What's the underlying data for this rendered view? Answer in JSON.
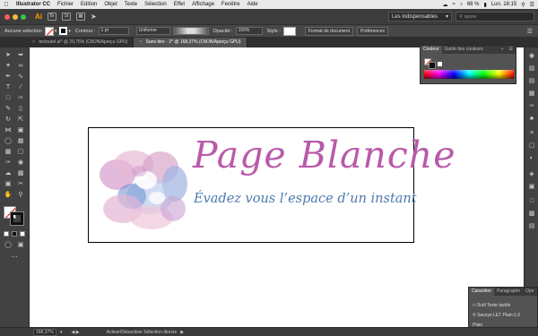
{
  "menubar": {
    "app_name": "Illustrator CC",
    "items": [
      "Fichier",
      "Edition",
      "Objet",
      "Texte",
      "Sélection",
      "Effet",
      "Affichage",
      "Fenêtre",
      "Aide"
    ],
    "battery": "68 %",
    "clock": "Lun. 18:15"
  },
  "appbar": {
    "logo": "Ai",
    "bridge_icon": "Br",
    "stock_icon": "St",
    "workspace": "Les indispensables",
    "search_placeholder": "spore"
  },
  "controlbar": {
    "selection_label": "Aucune sélection",
    "stroke_label": "Contour :",
    "stroke_weight": "1 pt",
    "stroke_profile": "Uniforme",
    "opacity_label": "Opacité :",
    "opacity_value": "100%",
    "style_label": "Style :",
    "document_format_button": "Format de document",
    "preferences_button": "Préférences"
  },
  "tabs": [
    {
      "label": "tectoutel.ai* @ 29,75% (CMJN/Aperçu GPU)",
      "active": false
    },
    {
      "label": "Sans titre - 2* @ 168,37% (CMJN/Aperçu GPU)",
      "active": true
    }
  ],
  "logo": {
    "title": "Page Blanche",
    "subtitle": "Évadez vous l’espace d’un instant",
    "title_color": "#b95aa9",
    "subtitle_color": "#4d79ad"
  },
  "color_panel": {
    "tab_color": "Couleur",
    "tab_guide": "Guide des couleurs"
  },
  "character_panel": {
    "tab_character": "Caractère",
    "tab_paragraph": "Paragraphe",
    "tab_opentype": "Ope",
    "touch_type_tool": "Outil Texte tactile",
    "font_family": "Savoye LET Plain:1.0",
    "font_style": "Plain"
  },
  "statusbar": {
    "zoom": "168,37%",
    "status_text": "Activer/Désactiver Sélection directe"
  },
  "colors": {
    "accent_orange": "#ff9a00",
    "panel_bg": "#535353"
  }
}
